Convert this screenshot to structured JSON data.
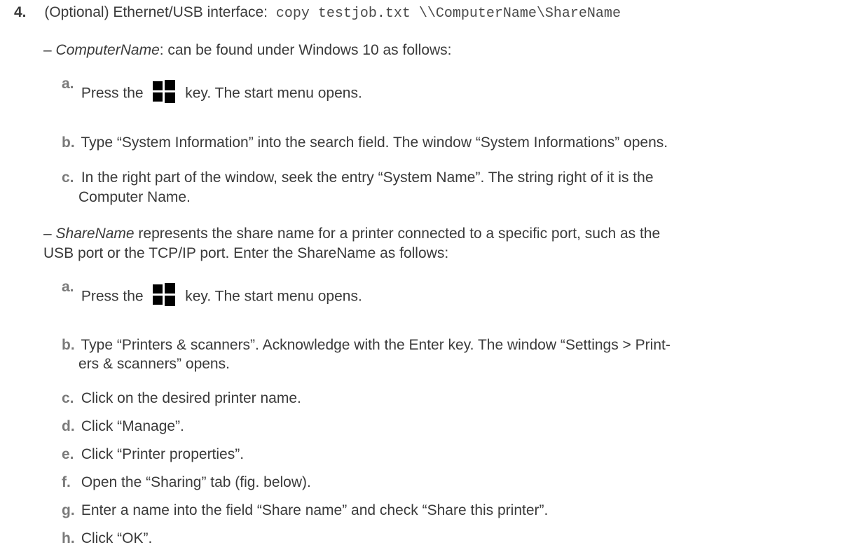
{
  "step4": {
    "number": "4.",
    "label": "(Optional) Ethernet/USB interface:",
    "command": "copy testjob.txt \\\\ComputerName\\ShareName"
  },
  "computer_name": {
    "dash": "–",
    "term": "ComputerName",
    "text": ": can be found under Windows 10 as follows:",
    "steps": [
      {
        "letter": "a.",
        "before": "Press the",
        "after": "key. The start menu opens.",
        "icon": "windows-key-icon"
      },
      {
        "letter": "b.",
        "text": "Type “System Information” into the search field. The window “System Informations” opens."
      },
      {
        "letter": "c.",
        "line1": "In the right part of the window, seek the entry “System Name”. The string right of it is the",
        "line2": "Computer Name."
      }
    ]
  },
  "share_name": {
    "dash": "–",
    "term": "ShareName",
    "text": " represents the share name for a printer connected to a specific port, such as the",
    "text2": "USB port or the TCP/IP port. Enter the ShareName as follows:",
    "steps": [
      {
        "letter": "a.",
        "before": "Press the",
        "after": "key. The start menu opens.",
        "icon": "windows-key-icon"
      },
      {
        "letter": "b.",
        "line1": "Type “Printers & scanners”. Acknowledge with the Enter key. The window “Settings > Print-",
        "line2": "ers & scanners” opens."
      },
      {
        "letter": "c.",
        "text": "Click on the desired printer name."
      },
      {
        "letter": "d.",
        "text": "Click “Manage”."
      },
      {
        "letter": "e.",
        "text": "Click “Printer properties”."
      },
      {
        "letter": "f.",
        "text": "Open the “Sharing” tab (fig. below)."
      },
      {
        "letter": "g.",
        "text": "Enter a name into the field “Share name” and check “Share this printer”."
      },
      {
        "letter": "h.",
        "text": "Click “OK”."
      }
    ]
  }
}
